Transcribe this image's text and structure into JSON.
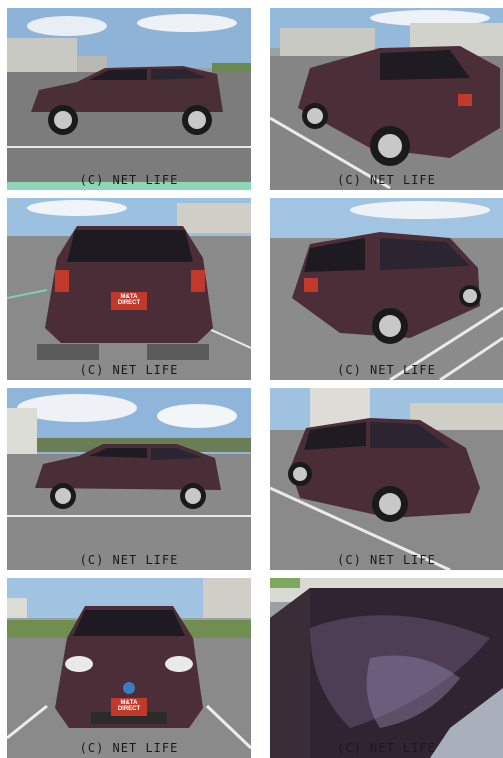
{
  "gallery": {
    "watermark": "(C) NET LIFE",
    "plate_text": "M&TA DIRECT",
    "photos": [
      {
        "view": "side-left"
      },
      {
        "view": "rear-left-3q"
      },
      {
        "view": "rear"
      },
      {
        "view": "rear-right-3q"
      },
      {
        "view": "side-left-2"
      },
      {
        "view": "front-right-3q"
      },
      {
        "view": "front"
      },
      {
        "view": "roof"
      }
    ]
  }
}
